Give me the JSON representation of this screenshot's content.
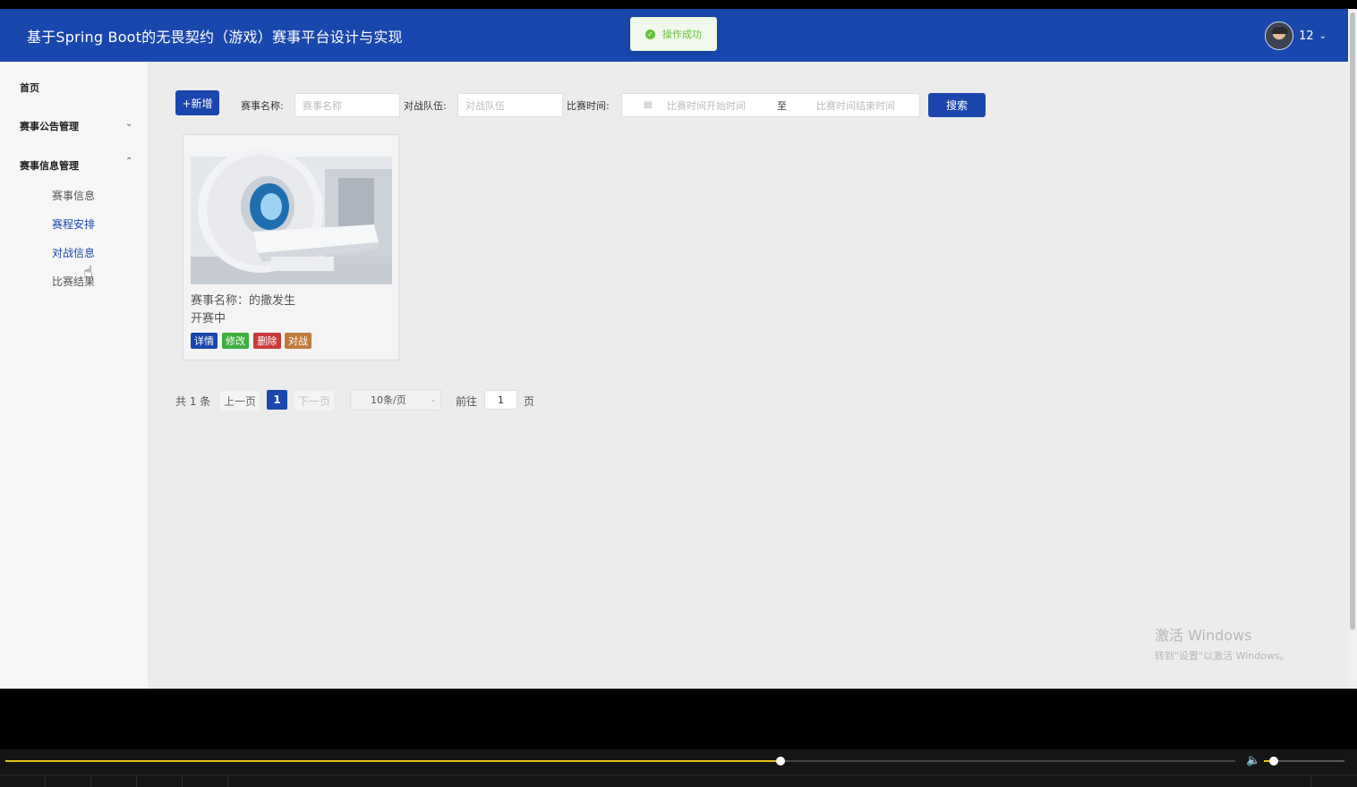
{
  "header": {
    "title": "基于Spring Boot的无畏契约（游戏）赛事平台设计与实现",
    "user_name": "12",
    "toast_text": "操作成功"
  },
  "sidebar": {
    "home": "首页",
    "group1": "赛事公告管理",
    "group2": "赛事信息管理",
    "sub_items": [
      "赛事信息",
      "赛程安排",
      "对战信息",
      "比赛结果"
    ]
  },
  "toolbar": {
    "add_label": "+新增",
    "name_label": "赛事名称:",
    "name_placeholder": "赛事名称",
    "team_label": "对战队伍:",
    "team_placeholder": "对战队伍",
    "time_label": "比赛时间:",
    "start_placeholder": "比赛时间开始时间",
    "range_sep": "至",
    "end_placeholder": "比赛时间结束时间",
    "search_label": "搜索"
  },
  "card": {
    "name": "赛事名称：的撒发生",
    "status": "开赛中",
    "actions": [
      "详情",
      "修改",
      "删除",
      "对战"
    ]
  },
  "pagination": {
    "total": "共 1 条",
    "prev": "上一页",
    "current": "1",
    "next": "下一页",
    "page_size": "10条/页",
    "goto_label": "前往",
    "goto_value": "1",
    "page_suffix": "页"
  },
  "watermark": {
    "line1": "激活 Windows",
    "line2": "转到\"设置\"以激活 Windows。"
  },
  "player": {
    "progress": 0.63,
    "volume": 0.12
  },
  "colors": {
    "primary": "#1a47ad",
    "success": "#67c23a",
    "tag_detail": "#1a47ad",
    "tag_edit": "#3fae3f",
    "tag_delete": "#c93a3a",
    "tag_battle": "#c07a3a"
  }
}
